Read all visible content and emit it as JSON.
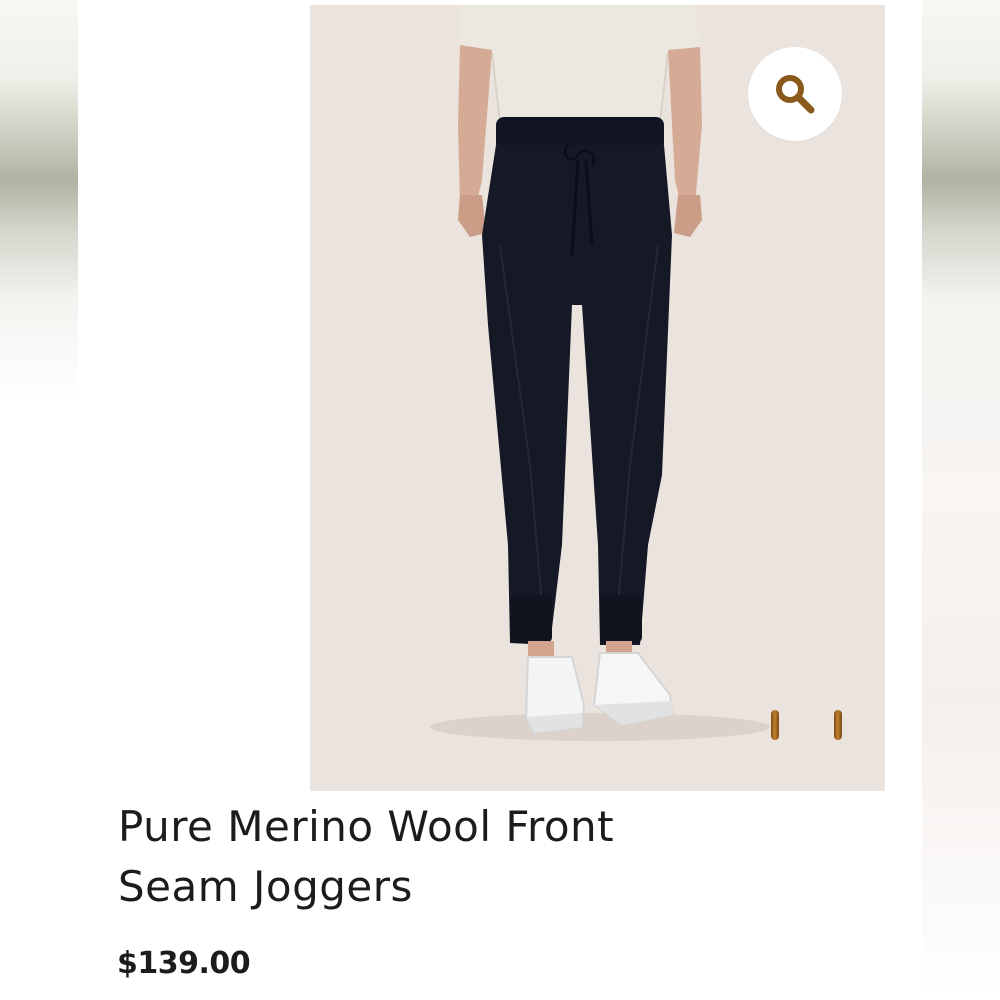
{
  "product": {
    "title_line1": "Pure Merino Wool Front",
    "title_line2": "Seam Joggers",
    "price": "$139.00"
  },
  "gallery": {
    "zoom_icon": "magnifier-icon",
    "pagination_dots": 2,
    "accent_color": "#8a5a1c",
    "image_background": "#ebe3de"
  }
}
